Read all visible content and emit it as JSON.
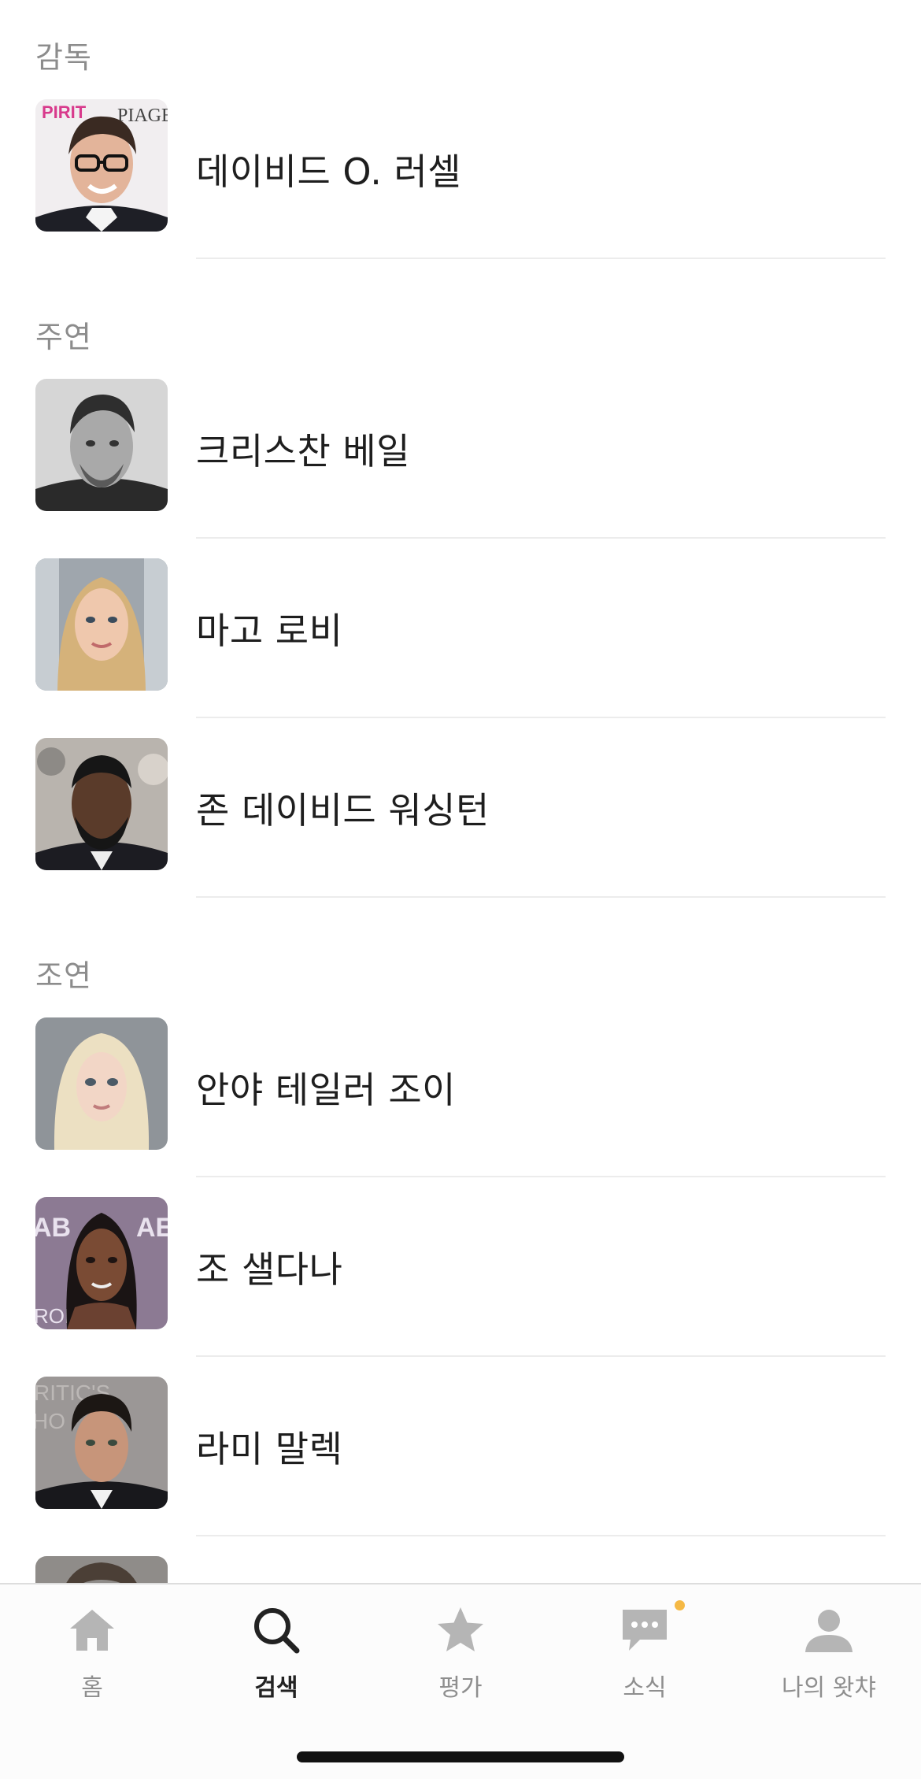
{
  "sections": {
    "director": {
      "title": "감독",
      "people": [
        {
          "name": "데이비드 O. 러셀"
        }
      ]
    },
    "lead": {
      "title": "주연",
      "people": [
        {
          "name": "크리스찬 베일"
        },
        {
          "name": "마고 로비"
        },
        {
          "name": "존 데이비드 워싱턴"
        }
      ]
    },
    "supporting": {
      "title": "조연",
      "people": [
        {
          "name": "안야 테일러 조이"
        },
        {
          "name": "조 샐다나"
        },
        {
          "name": "라미 말렉"
        }
      ]
    }
  },
  "tabbar": {
    "tabs": [
      {
        "label": "홈",
        "icon": "home-icon"
      },
      {
        "label": "검색",
        "icon": "search-icon",
        "active": true
      },
      {
        "label": "평가",
        "icon": "star-icon"
      },
      {
        "label": "소식",
        "icon": "chat-icon",
        "has_notification": true
      },
      {
        "label": "나의 왓챠",
        "icon": "person-icon"
      }
    ]
  },
  "colors": {
    "section_title": "#8c8c8c",
    "name_text": "#1e1e1e",
    "divider": "#ececec",
    "tab_inactive": "#b5b5b5",
    "tab_active": "#222222",
    "notification_dot": "#f5b945"
  }
}
